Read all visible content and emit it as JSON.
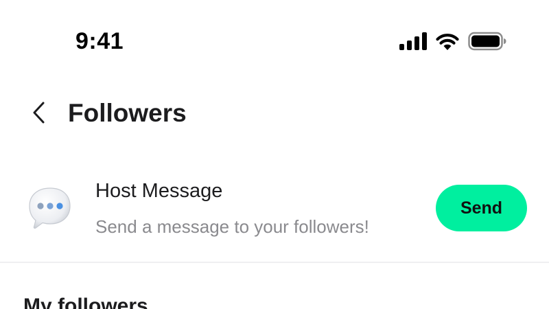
{
  "status_bar": {
    "time": "9:41",
    "icons": [
      "signal-icon",
      "wifi-icon",
      "battery-icon"
    ]
  },
  "header": {
    "back_icon": "chevron-left-icon",
    "title": "Followers"
  },
  "host_message": {
    "icon": "chat-bubble-icon",
    "title": "Host Message",
    "subtitle": "Send a message to your followers!",
    "send_label": "Send"
  },
  "followers_section": {
    "title": "My followers"
  },
  "colors": {
    "accent": "#00ef9f",
    "text_primary": "#1c1c1e",
    "text_secondary": "#8a8a8e",
    "divider": "#efeff1",
    "bubble_dots": "#4a90e2"
  }
}
